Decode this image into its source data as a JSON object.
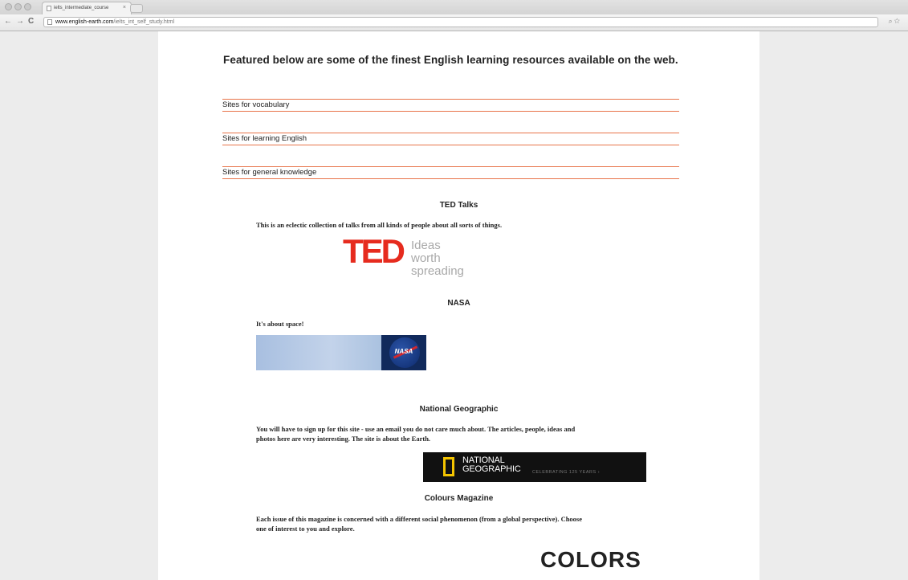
{
  "browser": {
    "tab_title": "ielts_intermediate_course",
    "tab_close": "×",
    "back": "←",
    "forward": "→",
    "reload": "C",
    "url_host": "www.english-earth.com",
    "url_path": "/ielts_int_self_study.html",
    "toolbar_icons": "⌕☆"
  },
  "page": {
    "intro": "Featured below are some of the finest English learning resources available on the web.",
    "site_links": [
      "Sites for vocabulary",
      "Sites for learning English",
      "Sites for general knowledge"
    ],
    "sections": [
      {
        "title": "TED Talks",
        "description": "This is an eclectic collection of talks from all kinds of people about all sorts of things.",
        "logo_word": "TED",
        "logo_tag_1": "Ideas worth",
        "logo_tag_2": "spreading"
      },
      {
        "title": "NASA",
        "description": "It's about space!",
        "logo_word": "NASA"
      },
      {
        "title": "National Geographic",
        "description_1": "You will have to sign up for this site - use an email you do not care much about. The articles, people, ideas and",
        "description_2": "photos here are very interesting. The site is about the Earth.",
        "logo_line_1": "NATIONAL",
        "logo_line_2": "GEOGRAPHIC",
        "logo_tag": "CELEBRATING 125 YEARS ›"
      },
      {
        "title": "Colours Magazine",
        "description_1": "Each issue of this magazine is concerned with a different social phenomenon (from a global perspective). Choose",
        "description_2": "one of interest to you and explore.",
        "logo_word": "COLORS"
      }
    ]
  }
}
